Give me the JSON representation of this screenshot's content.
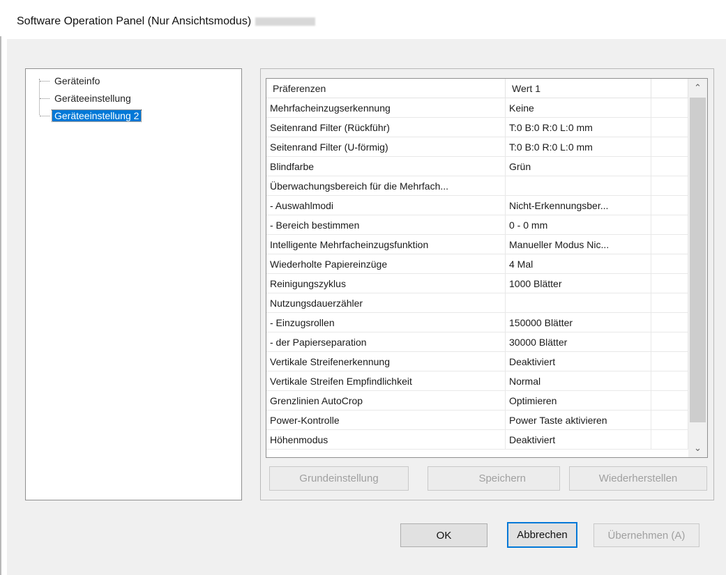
{
  "window": {
    "title": "Software Operation Panel (Nur Ansichtsmodus)"
  },
  "tree": {
    "items": [
      {
        "label": "Geräteinfo",
        "selected": false
      },
      {
        "label": "Geräteeinstellung",
        "selected": false
      },
      {
        "label": "Geräteeinstellung 2",
        "selected": true
      }
    ]
  },
  "table": {
    "columns": [
      "Präferenzen",
      "Wert 1",
      ""
    ],
    "rows": [
      {
        "name": "Mehrfacheinzugserkennung",
        "value": "Keine"
      },
      {
        "name": "Seitenrand Filter (Rückführ)",
        "value": "T:0  B:0  R:0  L:0 mm"
      },
      {
        "name": "Seitenrand Filter (U-förmig)",
        "value": "T:0  B:0  R:0  L:0 mm"
      },
      {
        "name": "Blindfarbe",
        "value": "Grün"
      },
      {
        "name": "Überwachungsbereich für die Mehrfach...",
        "value": ""
      },
      {
        "name": " - Auswahlmodi",
        "value": "Nicht-Erkennungsber..."
      },
      {
        "name": " - Bereich bestimmen",
        "value": "0 - 0 mm"
      },
      {
        "name": "Intelligente Mehrfacheinzugsfunktion",
        "value": "Manueller Modus  Nic..."
      },
      {
        "name": "Wiederholte Papiereinzüge",
        "value": "4 Mal"
      },
      {
        "name": "Reinigungszyklus",
        "value": "1000 Blätter"
      },
      {
        "name": "Nutzungsdauerzähler",
        "value": ""
      },
      {
        "name": " - Einzugsrollen",
        "value": "150000 Blätter"
      },
      {
        "name": " - der Papierseparation",
        "value": "30000 Blätter"
      },
      {
        "name": "Vertikale Streifenerkennung",
        "value": "Deaktiviert"
      },
      {
        "name": "Vertikale Streifen Empfindlichkeit",
        "value": "Normal"
      },
      {
        "name": "Grenzlinien AutoCrop",
        "value": "Optimieren"
      },
      {
        "name": "Power-Kontrolle",
        "value": "Power Taste aktivieren"
      },
      {
        "name": "Höhenmodus",
        "value": "Deaktiviert"
      }
    ],
    "scroll_up_glyph": "⌃",
    "scroll_down_glyph": "⌄"
  },
  "panel_buttons": {
    "default": "Grundeinstellung",
    "save": "Speichern",
    "restore": "Wiederherstellen"
  },
  "dialog_buttons": {
    "ok": "OK",
    "cancel": "Abbrechen",
    "apply": "Übernehmen (A)"
  },
  "colors": {
    "selection": "#0078d7",
    "dialog_bg": "#f0f0f0"
  }
}
